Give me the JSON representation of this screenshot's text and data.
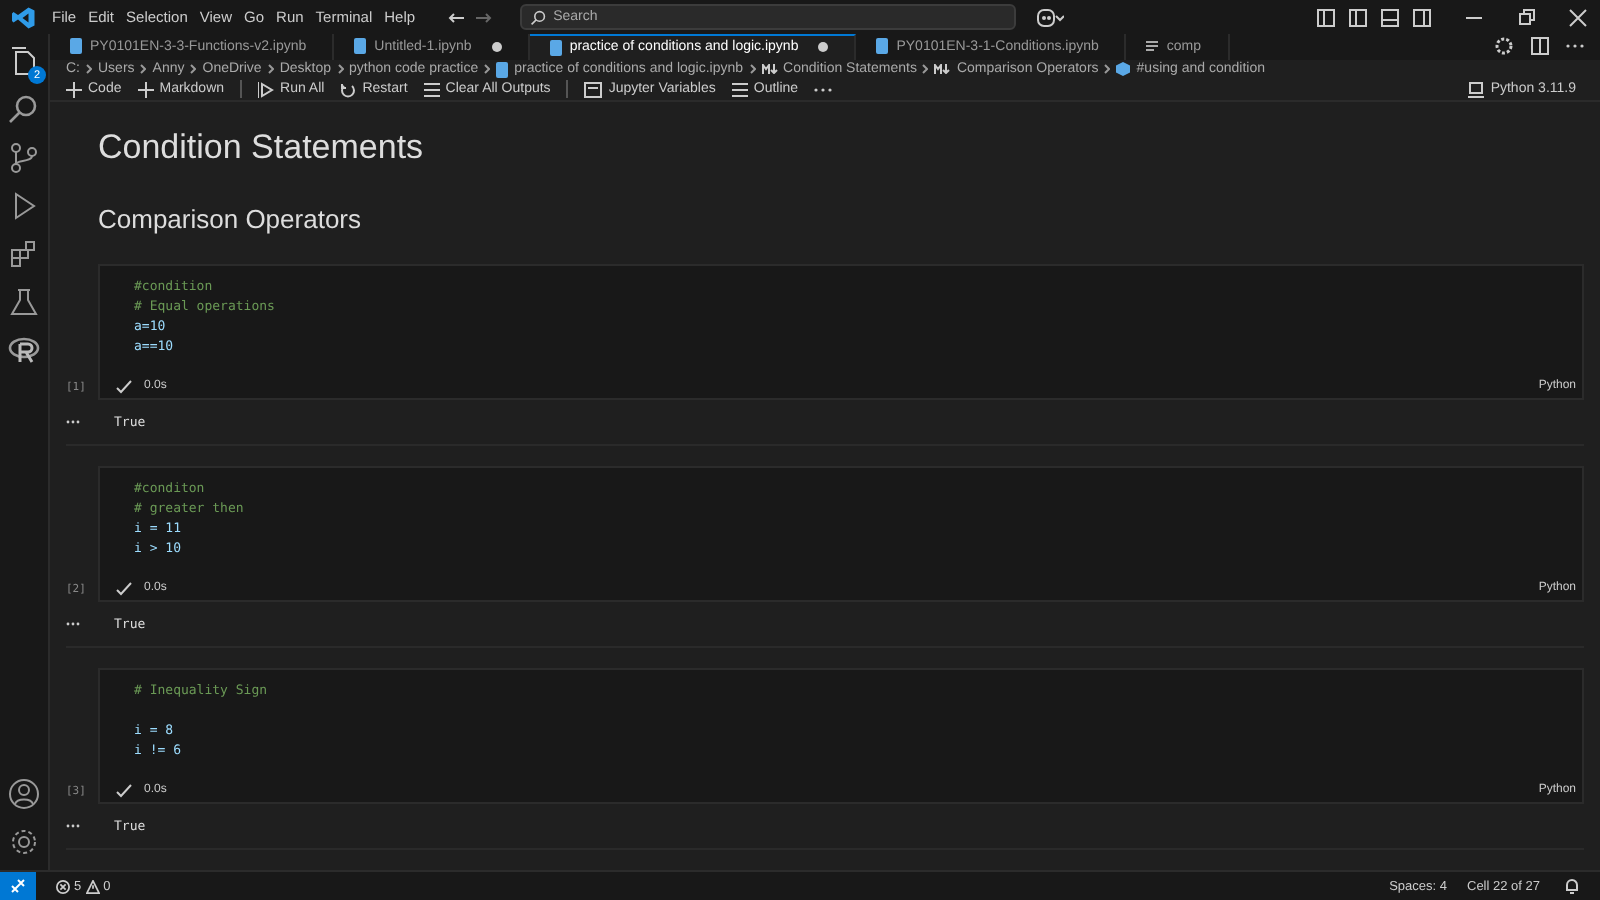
{
  "menu": [
    "File",
    "Edit",
    "Selection",
    "View",
    "Go",
    "Run",
    "Terminal",
    "Help"
  ],
  "search": {
    "placeholder": "Search"
  },
  "explorer_badge": "2",
  "tabs": [
    {
      "label": "PY0101EN-3-3-Functions-v2.ipynb",
      "selected": false,
      "modified": false,
      "kind": "notebook"
    },
    {
      "label": "Untitled-1.ipynb",
      "selected": false,
      "modified": true,
      "kind": "notebook"
    },
    {
      "label": "practice of conditions and logic.ipynb",
      "selected": true,
      "modified": true,
      "kind": "notebook"
    },
    {
      "label": "PY0101EN-3-1-Conditions.ipynb",
      "selected": false,
      "modified": false,
      "kind": "notebook"
    },
    {
      "label": "comp",
      "selected": false,
      "modified": false,
      "kind": "text"
    }
  ],
  "breadcrumb": [
    {
      "label": "C:",
      "kind": "plain"
    },
    {
      "label": "Users",
      "kind": "plain"
    },
    {
      "label": "Anny",
      "kind": "plain"
    },
    {
      "label": "OneDrive",
      "kind": "plain"
    },
    {
      "label": "Desktop",
      "kind": "plain"
    },
    {
      "label": "python code practice",
      "kind": "plain"
    },
    {
      "label": "practice of conditions and logic.ipynb",
      "kind": "notebook"
    },
    {
      "label": "Condition Statements",
      "kind": "markdown"
    },
    {
      "label": "Comparison Operators",
      "kind": "markdown"
    },
    {
      "label": "#using and condition",
      "kind": "code"
    }
  ],
  "toolbar": [
    {
      "label": "Code",
      "kind": "plus"
    },
    {
      "label": "Markdown",
      "kind": "plus"
    },
    {
      "label": "Run All",
      "kind": "run"
    },
    {
      "label": "Restart",
      "kind": "restart"
    },
    {
      "label": "Clear All Outputs",
      "kind": "clear"
    },
    {
      "label": "Jupyter Variables",
      "kind": "variables"
    },
    {
      "label": "Outline",
      "kind": "outline"
    }
  ],
  "kernel": "Python 3.11.9",
  "heading_1": "Condition Statements",
  "heading_2": "Comparison Operators",
  "cells": [
    {
      "count": "[1]",
      "time": "0.0s",
      "language": "Python",
      "output": "True",
      "lines": [
        {
          "kind": "comment",
          "text": "#condition"
        },
        {
          "kind": "comment",
          "text": "# Equal operations"
        },
        {
          "kind": "code",
          "text": "a=10"
        },
        {
          "kind": "code",
          "text": "a==10"
        }
      ]
    },
    {
      "count": "[2]",
      "time": "0.0s",
      "language": "Python",
      "output": "True",
      "lines": [
        {
          "kind": "comment",
          "text": "#conditon"
        },
        {
          "kind": "comment",
          "text": "# greater then"
        },
        {
          "kind": "code",
          "text": "i = 11"
        },
        {
          "kind": "code",
          "text": "i > 10"
        }
      ]
    },
    {
      "count": "[3]",
      "time": "0.0s",
      "language": "Python",
      "output": "True",
      "lines": [
        {
          "kind": "comment",
          "text": "# Inequality Sign"
        },
        {
          "kind": "blank"
        },
        {
          "kind": "code",
          "text": "i = 8"
        },
        {
          "kind": "code",
          "text": "i != 6"
        }
      ]
    }
  ],
  "status_bar": {
    "errors": "5",
    "warnings": "0",
    "spaces": "Spaces: 4",
    "cell": "Cell 22 of 27"
  }
}
